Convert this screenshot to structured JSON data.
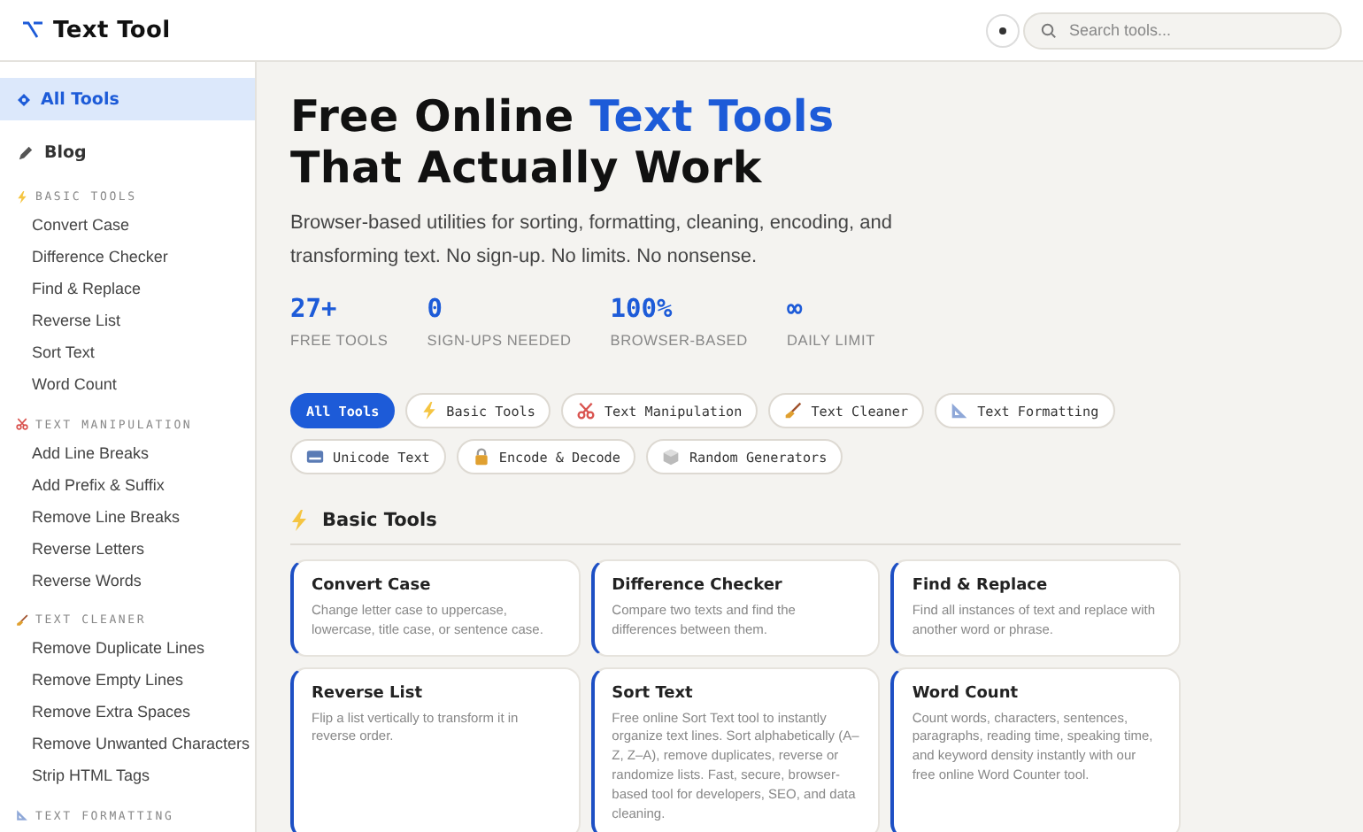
{
  "header": {
    "logo_text": "Text Tool",
    "search": {
      "placeholder": "Search tools..."
    }
  },
  "sidebar": {
    "top_items": [
      {
        "label": "All Tools",
        "selected": true
      },
      {
        "label": "Blog",
        "selected": false
      }
    ],
    "sections": [
      {
        "title": "BASIC TOOLS",
        "items": [
          "Convert Case",
          "Difference Checker",
          "Find & Replace",
          "Reverse List",
          "Sort Text",
          "Word Count"
        ]
      },
      {
        "title": "TEXT MANIPULATION",
        "items": [
          "Add Line Breaks",
          "Add Prefix & Suffix",
          "Remove Line Breaks",
          "Reverse Letters",
          "Reverse Words"
        ]
      },
      {
        "title": "TEXT CLEANER",
        "items": [
          "Remove Duplicate Lines",
          "Remove Empty Lines",
          "Remove Extra Spaces",
          "Remove Unwanted Characters",
          "Strip HTML Tags"
        ]
      },
      {
        "title": "TEXT FORMATTING"
      }
    ]
  },
  "hero": {
    "title_line_1": "Free Online ",
    "title_highlight": "Text Tools",
    "title_line_2": "That Actually Work",
    "subtitle": "Browser-based utilities for sorting, formatting, cleaning, encoding, and transforming text. No sign-up. No limits. No nonsense.",
    "stats": [
      {
        "value": "27+",
        "label": "FREE TOOLS"
      },
      {
        "value": "0",
        "label": "SIGN-UPS NEEDED"
      },
      {
        "value": "100%",
        "label": "BROWSER-BASED"
      },
      {
        "value": "∞",
        "label": "DAILY LIMIT"
      }
    ]
  },
  "filters": [
    {
      "label": "All Tools",
      "selected": true
    },
    {
      "label": "Basic Tools",
      "selected": false
    },
    {
      "label": "Text Manipulation",
      "selected": false
    },
    {
      "label": "Text Cleaner",
      "selected": false
    },
    {
      "label": "Text Formatting",
      "selected": false
    },
    {
      "label": "Unicode Text",
      "selected": false
    },
    {
      "label": "Encode & Decode",
      "selected": false
    },
    {
      "label": "Random Generators",
      "selected": false
    }
  ],
  "section": {
    "title": "Basic Tools",
    "cards": [
      {
        "title": "Convert Case",
        "description": "Change letter case to uppercase, lowercase, title case, or sentence case."
      },
      {
        "title": "Difference Checker",
        "description": "Compare two texts and find the differences between them."
      },
      {
        "title": "Find & Replace",
        "description": "Find all instances of text and replace with another word or phrase."
      },
      {
        "title": "Reverse List",
        "description": "Flip a list vertically to transform it in reverse order."
      },
      {
        "title": "Sort Text",
        "description": "Free online Sort Text tool to instantly organize text lines. Sort alphabetically (A–Z, Z–A), remove duplicates, reverse or randomize lists. Fast, secure, browser-based tool for developers, SEO, and data cleaning."
      },
      {
        "title": "Word Count",
        "description": "Count words, characters, sentences, paragraphs, reading time, speaking time, and keyword density instantly with our free online Word Counter tool."
      }
    ]
  }
}
